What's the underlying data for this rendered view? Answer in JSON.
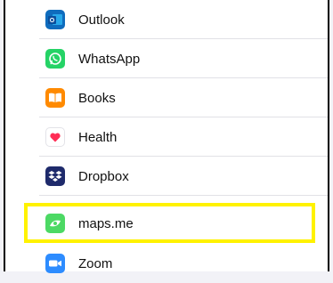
{
  "apps": [
    {
      "label": "Outlook",
      "icon": "outlook-icon",
      "color": "#0f6cbd"
    },
    {
      "label": "WhatsApp",
      "icon": "whatsapp-icon",
      "color": "#25d366"
    },
    {
      "label": "Books",
      "icon": "books-icon",
      "color": "#ff8a00"
    },
    {
      "label": "Health",
      "icon": "health-icon",
      "color": "#ff2d55"
    },
    {
      "label": "Dropbox",
      "icon": "dropbox-icon",
      "color": "#1e2a6b"
    },
    {
      "label": "maps.me",
      "icon": "maps-me-icon",
      "color": "#4cd964"
    },
    {
      "label": "Zoom",
      "icon": "zoom-icon",
      "color": "#2d8cff"
    }
  ],
  "highlight_color": "#fff200"
}
